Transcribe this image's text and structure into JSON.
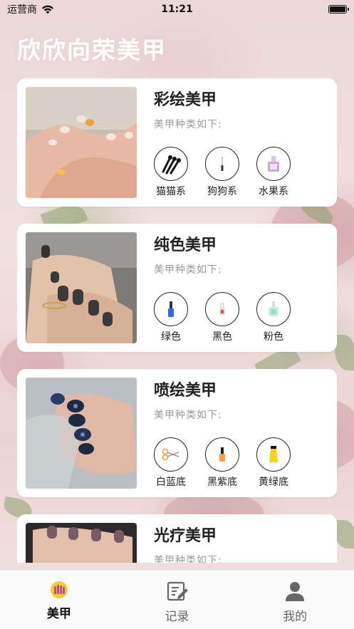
{
  "status_bar": {
    "carrier": "运营商",
    "time": "11:21",
    "battery_level": 1.0
  },
  "page_title": "欣欣向荣美甲",
  "cards": [
    {
      "title": "彩绘美甲",
      "subtitle": "美甲种类如下:",
      "image_icon": "painted-nails-photo",
      "types": [
        {
          "label": "猫猫系",
          "icon": "brushes-icon"
        },
        {
          "label": "狗狗系",
          "icon": "brush-icon"
        },
        {
          "label": "水果系",
          "icon": "polish-bottle-icon"
        }
      ]
    },
    {
      "title": "纯色美甲",
      "subtitle": "美甲种类如下:",
      "image_icon": "dark-nails-photo",
      "types": [
        {
          "label": "绿色",
          "icon": "blue-polish-icon"
        },
        {
          "label": "黑色",
          "icon": "red-polish-icon"
        },
        {
          "label": "粉色",
          "icon": "green-polish-icon"
        }
      ]
    },
    {
      "title": "喷绘美甲",
      "subtitle": "美甲种类如下:",
      "image_icon": "blue-nails-photo",
      "types": [
        {
          "label": "白蓝底",
          "icon": "scissors-icon"
        },
        {
          "label": "黑紫底",
          "icon": "orange-polish-icon"
        },
        {
          "label": "黄绿底",
          "icon": "yellow-tube-icon"
        }
      ]
    },
    {
      "title": "光疗美甲",
      "subtitle": "美甲种类如下:",
      "image_icon": "nude-nails-photo",
      "types": []
    }
  ],
  "tabs": [
    {
      "label": "美甲",
      "icon": "nail-polish-tab-icon",
      "active": true
    },
    {
      "label": "记录",
      "icon": "edit-note-icon",
      "active": false
    },
    {
      "label": "我的",
      "icon": "person-icon",
      "active": false
    }
  ],
  "colors": {
    "title": "#ffffff",
    "card_bg": "#ffffff",
    "subtitle": "#9a9a9a",
    "tab_active": "#111111"
  }
}
